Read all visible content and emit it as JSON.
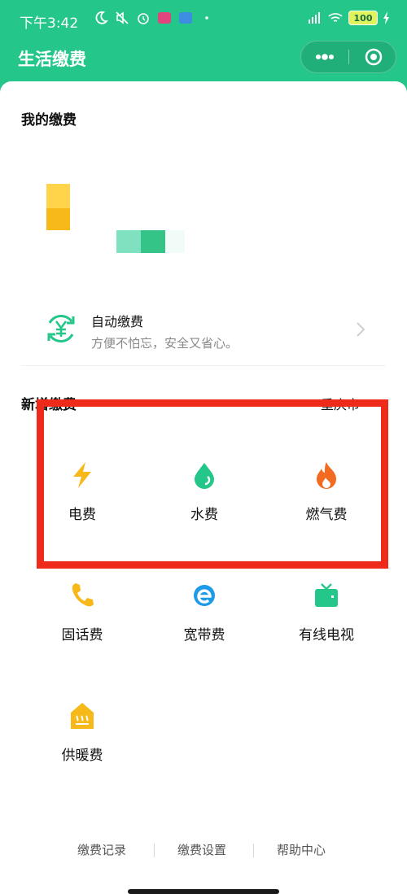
{
  "status_bar": {
    "time": "下午3:42",
    "battery": "100"
  },
  "header": {
    "title": "生活缴费",
    "icons": [
      "more-icon",
      "close-target-icon"
    ]
  },
  "my_payments": {
    "title": "我的缴费"
  },
  "auto_pay": {
    "title": "自动缴费",
    "subtitle": "方便不怕忘，安全又省心。"
  },
  "new_payment": {
    "title": "新增缴费",
    "city": "重庆市",
    "items": [
      {
        "label": "电费",
        "icon": "lightning-icon"
      },
      {
        "label": "水费",
        "icon": "water-drop-icon"
      },
      {
        "label": "燃气费",
        "icon": "flame-icon"
      },
      {
        "label": "固话费",
        "icon": "phone-icon"
      },
      {
        "label": "宽带费",
        "icon": "broadband-e-icon"
      },
      {
        "label": "有线电视",
        "icon": "tv-icon"
      },
      {
        "label": "供暖费",
        "icon": "heating-icon"
      }
    ]
  },
  "footer": {
    "links": [
      "缴费记录",
      "缴费设置",
      "帮助中心"
    ]
  },
  "colors": {
    "brand_green": "#25c68a",
    "highlight_red": "#ee2b1b",
    "icon_yellow": "#f7b81a",
    "icon_green": "#25c68a",
    "icon_orange": "#f26b21",
    "icon_blue": "#1e9be8"
  }
}
